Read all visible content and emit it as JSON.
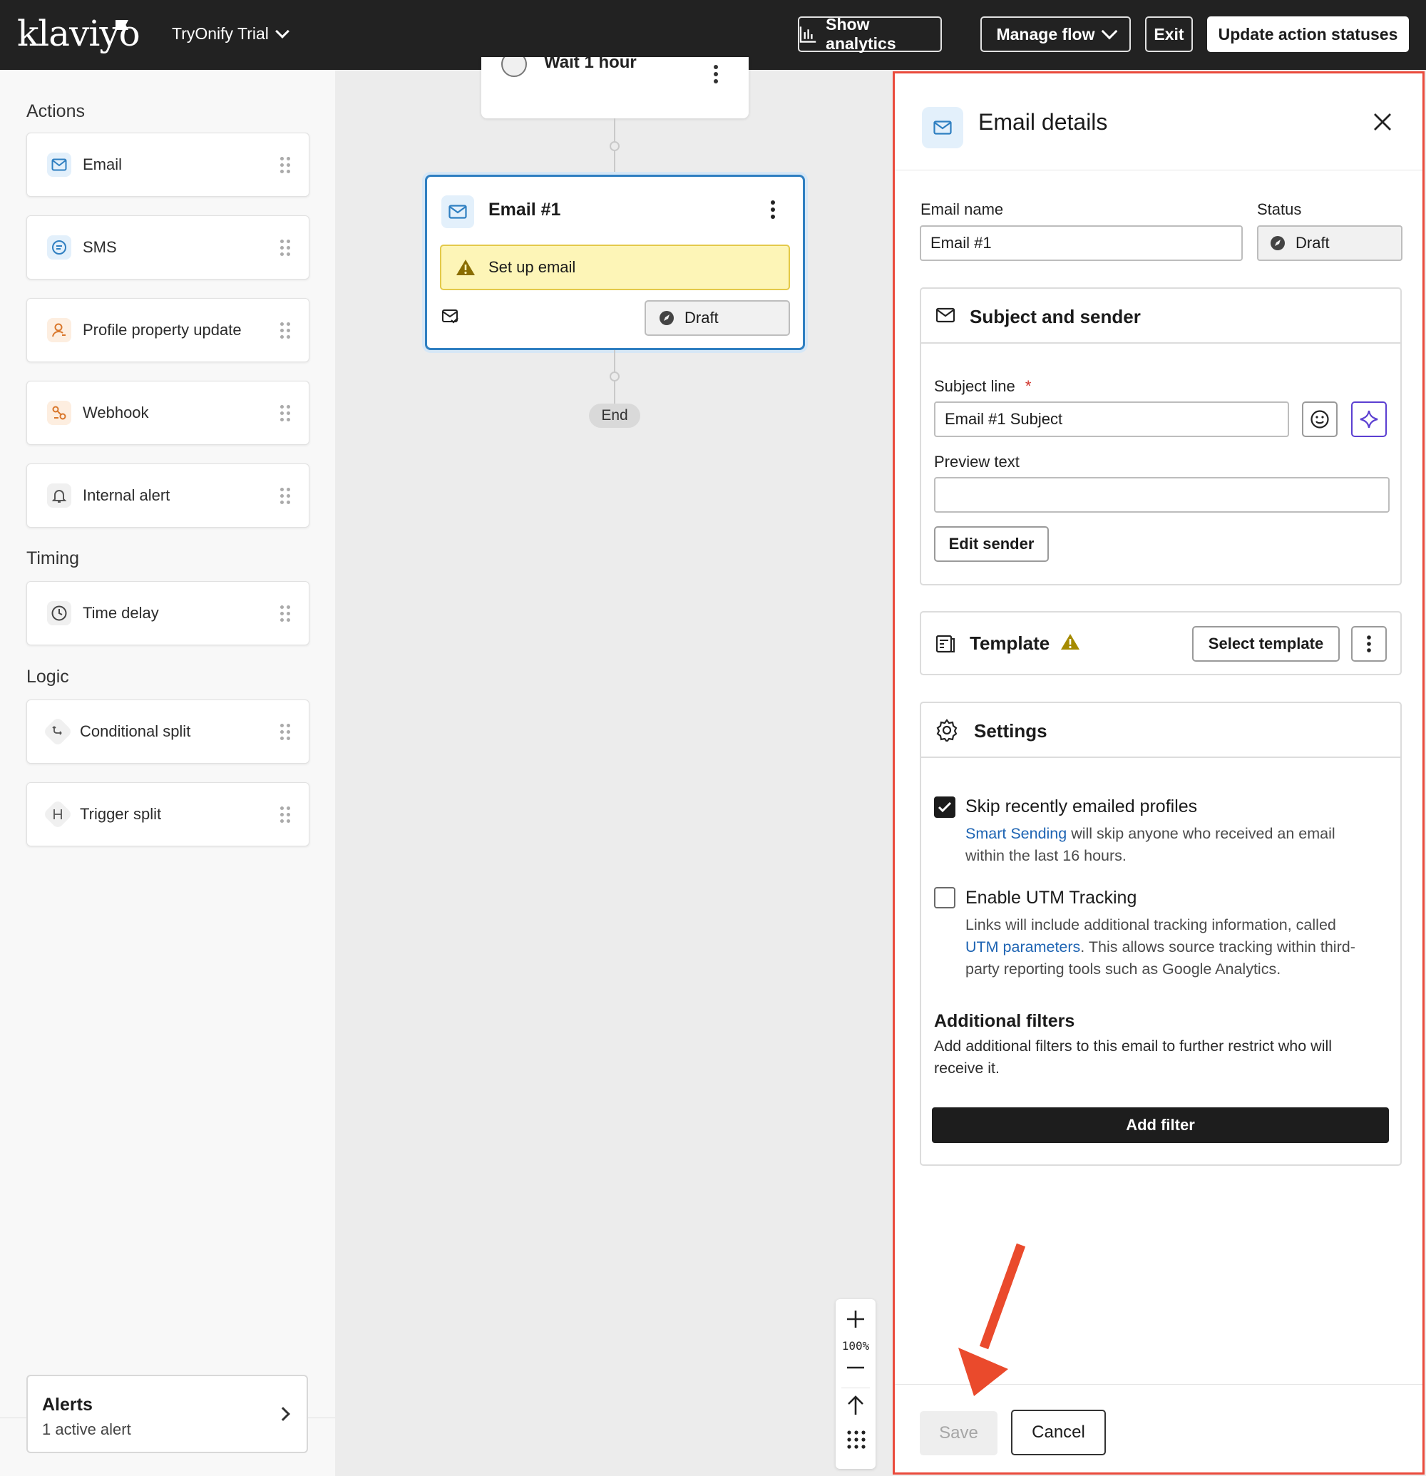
{
  "header": {
    "logo": "klaviyo",
    "account_name": "TryOnify Trial",
    "show_analytics": "Show analytics",
    "manage_flow": "Manage flow",
    "exit": "Exit",
    "update_statuses": "Update action statuses"
  },
  "sidebar": {
    "actions_title": "Actions",
    "actions": [
      {
        "label": "Email",
        "icon": "mail-icon"
      },
      {
        "label": "SMS",
        "icon": "sms-icon"
      },
      {
        "label": "Profile property update",
        "icon": "profile-icon"
      },
      {
        "label": "Webhook",
        "icon": "webhook-icon"
      },
      {
        "label": "Internal alert",
        "icon": "bell-icon"
      }
    ],
    "timing_title": "Timing",
    "timing": [
      {
        "label": "Time delay",
        "icon": "clock-icon"
      }
    ],
    "logic_title": "Logic",
    "logic": [
      {
        "label": "Conditional split",
        "icon": "split-icon"
      },
      {
        "label": "Trigger split",
        "icon": "trigger-split-icon"
      }
    ],
    "alerts": {
      "title": "Alerts",
      "subtitle": "1 active alert"
    }
  },
  "canvas": {
    "wait_node": "Wait 1 hour",
    "email_node": {
      "title": "Email #1",
      "warning": "Set up email",
      "status": "Draft"
    },
    "end_label": "End",
    "zoom_level": "100%"
  },
  "panel": {
    "title": "Email details",
    "email_name_label": "Email name",
    "email_name_value": "Email #1",
    "status_label": "Status",
    "status_value": "Draft",
    "subject_sender": {
      "title": "Subject and sender",
      "subject_label": "Subject line",
      "required_mark": "*",
      "subject_value": "Email #1 Subject",
      "preview_label": "Preview text",
      "preview_value": "",
      "edit_sender": "Edit sender"
    },
    "template": {
      "title": "Template",
      "select": "Select template"
    },
    "settings": {
      "title": "Settings",
      "skip_title": "Skip recently emailed profiles",
      "skip_checked": true,
      "skip_link": "Smart Sending",
      "skip_desc_1": " will skip anyone who received an email",
      "skip_desc_2": "within the last 16 hours.",
      "utm_title": "Enable UTM Tracking",
      "utm_checked": false,
      "utm_desc_1": "Links will include additional tracking information, called",
      "utm_link": "UTM parameters",
      "utm_desc_2": ". This allows source tracking within third-",
      "utm_desc_3": "party reporting tools such as Google Analytics.",
      "filters_title": "Additional filters",
      "filters_desc_1": "Add additional filters to this email to further restrict who will",
      "filters_desc_2": "receive it.",
      "add_filter": "Add filter"
    },
    "save": "Save",
    "cancel": "Cancel"
  },
  "colors": {
    "topbar": "#222222",
    "selection": "#2f7fc1",
    "warning_bg": "#fdf5b7",
    "link": "#1e64b3",
    "highlight_border": "#ea4a3c",
    "arrow": "#ea4a2c"
  }
}
